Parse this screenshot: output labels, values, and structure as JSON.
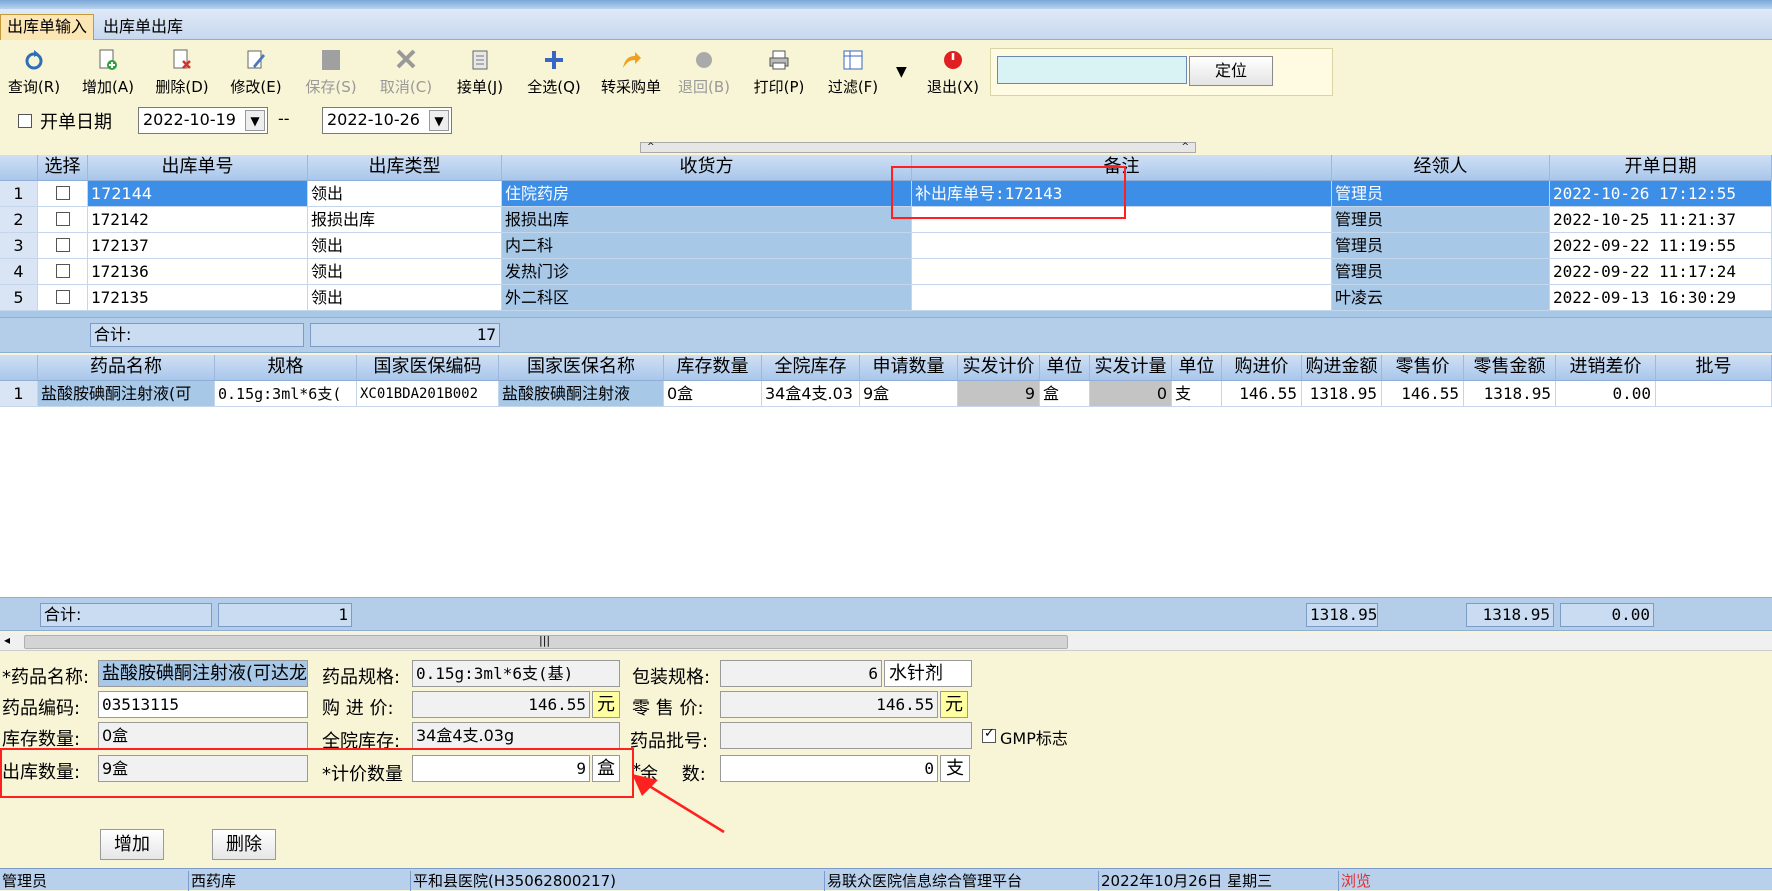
{
  "tabs": [
    "出库单输入",
    "出库单出库"
  ],
  "toolbar": [
    {
      "label": "查询(R)",
      "icon": "refresh-icon",
      "enabled": true
    },
    {
      "label": "增加(A)",
      "icon": "add-doc-icon",
      "enabled": true
    },
    {
      "label": "删除(D)",
      "icon": "delete-doc-icon",
      "enabled": true
    },
    {
      "label": "修改(E)",
      "icon": "edit-icon",
      "enabled": true
    },
    {
      "label": "保存(S)",
      "icon": "save-icon",
      "enabled": false
    },
    {
      "label": "取消(C)",
      "icon": "cancel-icon",
      "enabled": false
    },
    {
      "label": "接单(J)",
      "icon": "receive-order-icon",
      "enabled": true
    },
    {
      "label": "全选(Q)",
      "icon": "plus-icon",
      "enabled": true
    },
    {
      "label": "转采购单",
      "icon": "convert-arrow-icon",
      "enabled": true
    },
    {
      "label": "退回(B)",
      "icon": "return-icon",
      "enabled": false
    },
    {
      "label": "打印(P)",
      "icon": "printer-icon",
      "enabled": true
    },
    {
      "label": "过滤(F)",
      "icon": "filter-icon",
      "enabled": true
    },
    {
      "label": "退出(X)",
      "icon": "power-icon",
      "enabled": true
    }
  ],
  "locate": {
    "input_value": "",
    "button_label": "定位"
  },
  "filter": {
    "date_label": "开单日期",
    "date_from": "2022-10-19",
    "separator": "--",
    "date_to": "2022-10-26",
    "checked": false
  },
  "orders": {
    "columns": [
      "选择",
      "出库单号",
      "出库类型",
      "收货方",
      "备注",
      "经领人",
      "开单日期"
    ],
    "rows": [
      {
        "no": "1",
        "id": "172144",
        "type": "领出",
        "receiver": "住院药房",
        "remark": "补出库单号:172143",
        "handler": "管理员",
        "date": "2022-10-26 17:12:55"
      },
      {
        "no": "2",
        "id": "172142",
        "type": "报损出库",
        "receiver": "报损出库",
        "remark": "",
        "handler": "管理员",
        "date": "2022-10-25 11:21:37"
      },
      {
        "no": "3",
        "id": "172137",
        "type": "领出",
        "receiver": "内二科",
        "remark": "",
        "handler": "管理员",
        "date": "2022-09-22 11:19:55"
      },
      {
        "no": "4",
        "id": "172136",
        "type": "领出",
        "receiver": "发热门诊",
        "remark": "",
        "handler": "管理员",
        "date": "2022-09-22 11:17:24"
      },
      {
        "no": "5",
        "id": "172135",
        "type": "领出",
        "receiver": "外二科区",
        "remark": "",
        "handler": "叶凌云",
        "date": "2022-09-13 16:30:29"
      }
    ],
    "total_label": "合计:",
    "total_count": "17"
  },
  "details": {
    "columns": [
      "药品名称",
      "规格",
      "国家医保编码",
      "国家医保名称",
      "库存数量",
      "全院库存",
      "申请数量",
      "实发计价",
      "单位",
      "实发计量",
      "单位",
      "购进价",
      "购进金额",
      "零售价",
      "零售金额",
      "进销差价",
      "批号"
    ],
    "rows": [
      {
        "no": "1",
        "cells": [
          "盐酸胺碘酮注射液(可",
          "0.15g:3ml*6支(",
          "XC01BDA201B002",
          "盐酸胺碘酮注射液",
          "0盒",
          "34盒4支.03",
          "9盒",
          "9",
          "盒",
          "0",
          "支",
          "146.55",
          "1318.95",
          "146.55",
          "1318.95",
          "0.00",
          ""
        ]
      }
    ],
    "total_label": "合计:",
    "total_count": "1",
    "total_purchase": "1318.95",
    "total_retail": "1318.95",
    "total_diff": "0.00"
  },
  "form": {
    "drug_name_label": "*药品名称:",
    "drug_name": "盐酸胺碘酮注射液(可达龙",
    "spec_label": "药品规格:",
    "spec": "0.15g:3ml*6支(基)",
    "pack_label": "包装规格:",
    "pack": "6",
    "dosage_form": "水针剂",
    "code_label": "药品编码:",
    "code": "03513115",
    "purchase_price_label": "购 进 价:",
    "purchase_price": "146.55",
    "price_unit": "元",
    "retail_price_label": "零 售 价:",
    "retail_price": "146.55",
    "stock_label": "库存数量:",
    "stock": "0盒",
    "hospital_stock_label": "全院库存:",
    "hospital_stock": "34盒4支.03g",
    "batch_label": "药品批号:",
    "batch": "",
    "gmp_label": "GMP标志",
    "gmp_checked": true,
    "out_qty_label": "出库数量:",
    "out_qty": "9盒",
    "price_qty_label": "*计价数量",
    "price_qty": "9",
    "price_qty_unit": "盒",
    "remainder_label": "余　 数:",
    "remainder_prefix": "*",
    "remainder": "0",
    "remainder_unit": "支",
    "add_button": "增加",
    "delete_button": "删除"
  },
  "statusbar": [
    "管理员",
    "西药库",
    "平和县医院(H35062800217)",
    "易联众医院信息综合管理平台",
    "2022年10月26日 星期三",
    "浏览"
  ],
  "colors": {
    "selected_row": "#3d8ee6",
    "highlight_box": "#ff2020",
    "grid_blue": "#a8c8e8",
    "status_red": "#e03030"
  }
}
